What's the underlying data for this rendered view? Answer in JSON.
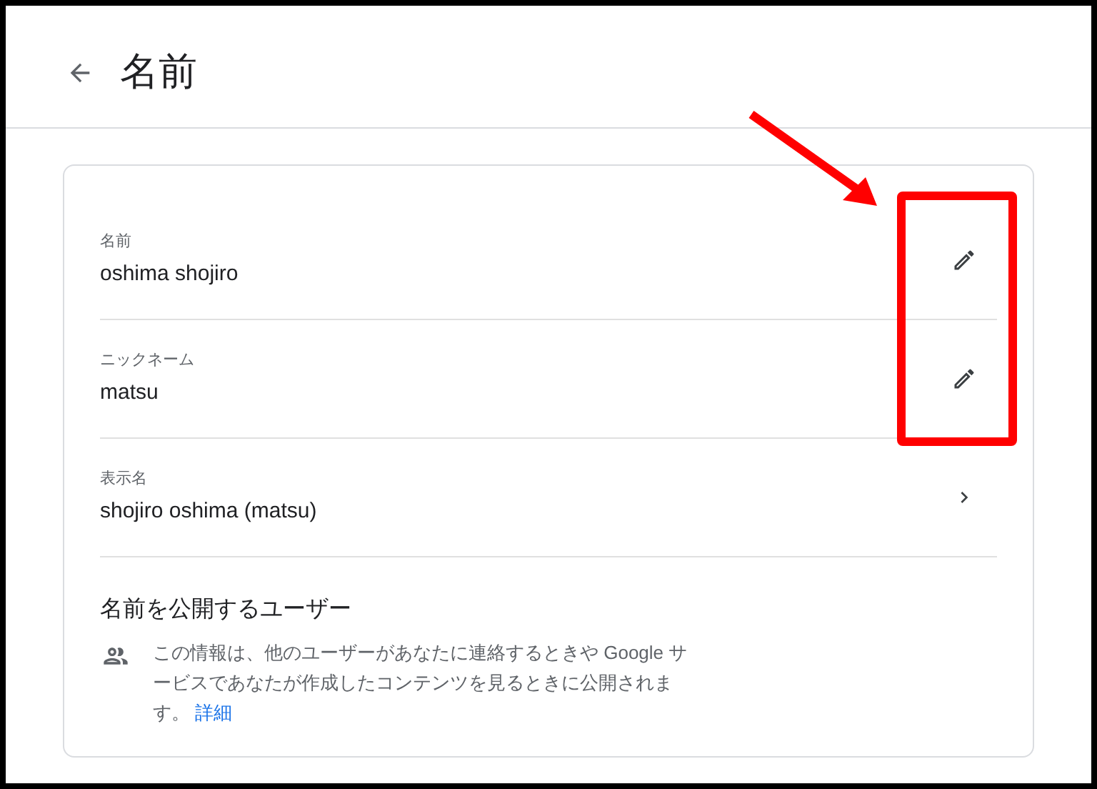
{
  "header": {
    "title": "名前"
  },
  "fields": [
    {
      "label": "名前",
      "value": "oshima shojiro",
      "kind": "edit"
    },
    {
      "label": "ニックネーム",
      "value": "matsu",
      "kind": "edit"
    },
    {
      "label": "表示名",
      "value": "shojiro oshima (matsu)",
      "kind": "open"
    }
  ],
  "visibility": {
    "title": "名前を公開するユーザー",
    "description": "この情報は、他のユーザーがあなたに連絡するときや Google サービスであなたが作成したコンテンツを見るときに公開されます。",
    "link": "詳細"
  }
}
